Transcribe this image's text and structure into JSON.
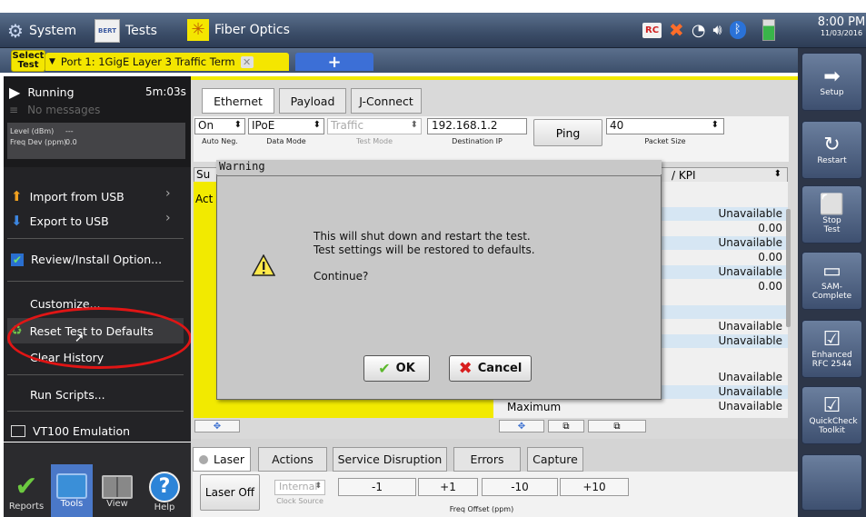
{
  "topbar": {
    "system_label": "System",
    "tests_label": "Tests",
    "fiber_label": "Fiber Optics",
    "time": "8:00 PM",
    "date": "11/03/2016",
    "tests_icon_text": "BERT"
  },
  "subbar": {
    "select_test": "Select Test",
    "port_tab": "Port 1: 1GigE Layer 3 Traffic Term",
    "add_tab": "+"
  },
  "status": {
    "state": "Running",
    "elapsed": "5m:03s",
    "messages": "No messages",
    "level_label": "Level (dBm)",
    "level_value": "---",
    "freq_label": "Freq Dev (ppm)",
    "freq_value": "0.0"
  },
  "menu": {
    "import_usb": "Import from USB",
    "export_usb": "Export to USB",
    "review_install": "Review/Install Option...",
    "customize": "Customize...",
    "reset_defaults": "Reset Test to Defaults",
    "clear_history": "Clear History",
    "run_scripts": "Run Scripts...",
    "vt100": "VT100 Emulation"
  },
  "bottom_left": {
    "reports": "Reports",
    "tools": "Tools",
    "view": "View",
    "help": "Help"
  },
  "tabs": {
    "ethernet": "Ethernet",
    "payload": "Payload",
    "jconnect": "J-Connect"
  },
  "controls": {
    "auto_neg_value": "On",
    "auto_neg_label": "Auto Neg.",
    "data_mode_value": "IPoE",
    "data_mode_label": "Data Mode",
    "test_mode_value": "Traffic",
    "test_mode_label": "Test Mode",
    "dest_ip_value": "192.168.1.2",
    "dest_ip_label": "Destination IP",
    "ping_label": "Ping",
    "packet_size_value": "40",
    "packet_size_label": "Packet Size"
  },
  "results": {
    "left_header": "Su",
    "left_sub": "Act",
    "right_header": "/ KPI",
    "rows": [
      "Unavailable",
      "0.00",
      "Unavailable",
      "0.00",
      "Unavailable",
      "0.00",
      "",
      "Unavailable",
      "Unavailable",
      "",
      "Unavailable",
      "Unavailable",
      "Unavailable"
    ],
    "maximum_label": "Maximum"
  },
  "dialog": {
    "title": "Warning",
    "line1": "This will shut down and restart the test.",
    "line2": "Test settings will be restored to defaults.",
    "line3": "Continue?",
    "ok_label": "OK",
    "cancel_label": "Cancel"
  },
  "bottom_tabs": {
    "laser": "Laser",
    "actions": "Actions",
    "service_disruption": "Service Disruption",
    "errors": "Errors",
    "capture": "Capture"
  },
  "laser_controls": {
    "laser_off": "Laser Off",
    "clock_value": "Internal",
    "clock_label": "Clock Source",
    "minus1": "-1",
    "plus1": "+1",
    "minus10": "-10",
    "plus10": "+10",
    "freq_offset_label": "Freq Offset (ppm)"
  },
  "right_toolbar": {
    "setup": "Setup",
    "restart": "Restart",
    "stop_test": "Stop Test",
    "sam_complete": "SAM-Complete",
    "enhanced_rfc": "Enhanced RFC 2544",
    "quickcheck": "QuickCheck Toolkit"
  },
  "colors": {
    "accent_yellow": "#f2ea00",
    "highlight_red": "#e01515",
    "toolbar_blue": "#3e5070"
  }
}
